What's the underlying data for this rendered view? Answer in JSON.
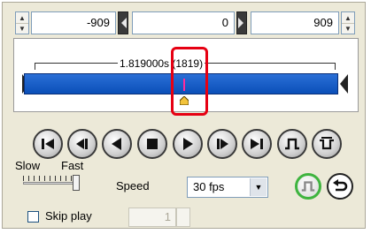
{
  "top_fields": {
    "start_value": "-909",
    "current_value": "0",
    "end_value": "909"
  },
  "timeline": {
    "time_label": "1.819000s (1819)",
    "highlight_color": "#e60012",
    "bar_color": "#1663cc",
    "cursor_color": "#ff2a9d"
  },
  "playback_buttons": [
    {
      "name": "first-frame-icon"
    },
    {
      "name": "step-back-icon"
    },
    {
      "name": "play-reverse-icon"
    },
    {
      "name": "stop-icon"
    },
    {
      "name": "play-icon"
    },
    {
      "name": "step-forward-icon"
    },
    {
      "name": "last-frame-icon"
    },
    {
      "name": "pulse-wave-icon"
    },
    {
      "name": "loop-pulse-icon"
    }
  ],
  "speed": {
    "slow_label": "Slow",
    "fast_label": "Fast",
    "speed_label": "Speed",
    "fps_value": "30 fps"
  },
  "skip_play": {
    "label": "Skip play",
    "checked": false,
    "value": "1"
  }
}
